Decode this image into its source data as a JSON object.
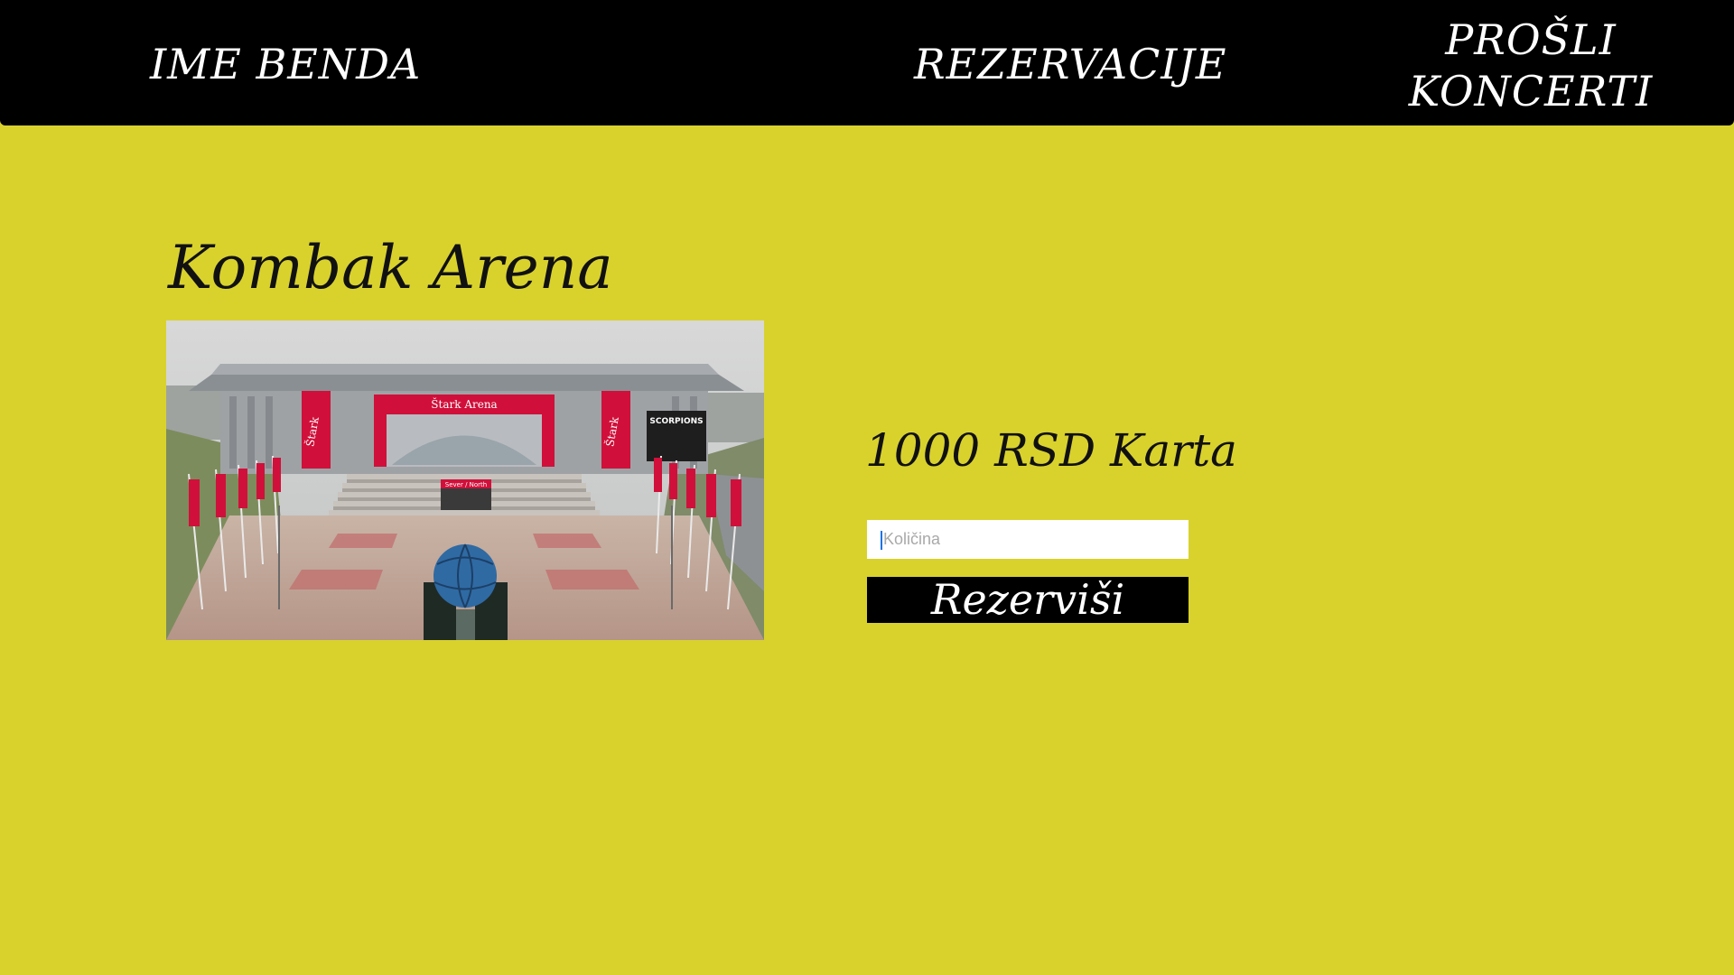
{
  "nav": {
    "brand": "IME BENDA",
    "reservations": "REZERVACIJE",
    "past_concerts": "PROŠLI KONCERTI"
  },
  "venue": {
    "title": "Kombak Arena",
    "image_alt": "Kombak Arena",
    "signage": {
      "arena_banner": "Štark Arena",
      "side_banner": "Štark",
      "poster": "SCORPIONS",
      "entrance_sign": "Sever / North"
    }
  },
  "booking": {
    "price": "1000 RSD Karta",
    "quantity_placeholder": "Količina",
    "quantity_value": "",
    "reserve_label": "Rezerviši"
  },
  "colors": {
    "page_background": "#d9d22d",
    "navbar_background": "#000000",
    "accent_red": "#d0103a"
  }
}
